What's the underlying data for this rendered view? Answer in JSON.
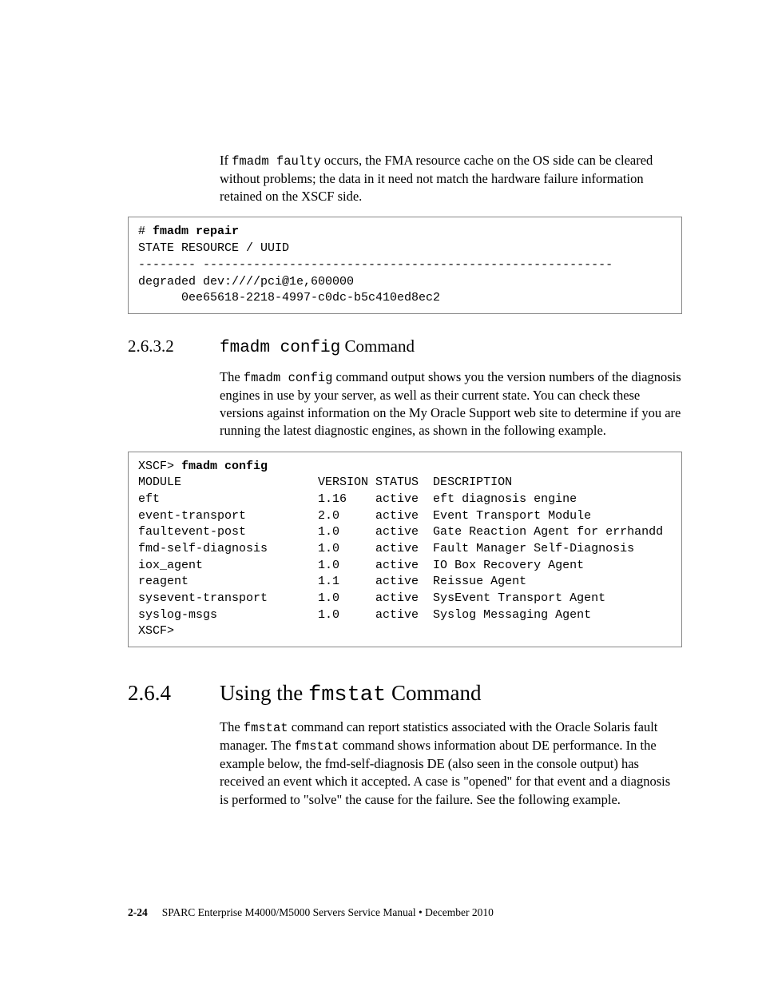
{
  "para1": {
    "pre": "If ",
    "code": "fmadm faulty",
    "post": " occurs, the FMA resource cache on the OS side can be cleared without problems; the data in it need not match the hardware failure information retained on the XSCF side."
  },
  "codebox1": {
    "prompt": "# ",
    "cmd": "fmadm repair",
    "line1": "STATE RESOURCE / UUID",
    "line2": "-------- ---------------------------------------------------------",
    "line3": "degraded dev:////pci@1e,600000",
    "line4": "      0ee65618-2218-4997-c0dc-b5c410ed8ec2"
  },
  "sec2632": {
    "num": "2.6.3.2",
    "title_pre": "",
    "title_code": "fmadm config",
    "title_post": " Command"
  },
  "para2": {
    "pre": "The ",
    "code": "fmadm config",
    "post": " command output shows you the version numbers of the diagnosis engines in use by your server, as well as their current state. You can check these versions against information on the My Oracle Support web site to determine if you are running the latest diagnostic engines, as shown in the following example."
  },
  "codebox2": {
    "prompt": "XSCF> ",
    "cmd": "fmadm config",
    "header": "MODULE                   VERSION STATUS  DESCRIPTION",
    "rows": [
      "eft                      1.16    active  eft diagnosis engine",
      "event-transport          2.0     active  Event Transport Module",
      "faultevent-post          1.0     active  Gate Reaction Agent for errhandd",
      "fmd-self-diagnosis       1.0     active  Fault Manager Self-Diagnosis",
      "iox_agent                1.0     active  IO Box Recovery Agent",
      "reagent                  1.1     active  Reissue Agent",
      "sysevent-transport       1.0     active  SysEvent Transport Agent",
      "syslog-msgs              1.0     active  Syslog Messaging Agent"
    ],
    "tail": "XSCF>"
  },
  "sec264": {
    "num": "2.6.4",
    "title_pre": "Using the ",
    "title_code": "fmstat",
    "title_post": " Command"
  },
  "para3": {
    "pre": "The ",
    "code1": " fmstat",
    "mid1": " command can report statistics associated with the Oracle Solaris fault manager. The ",
    "code2": "fmstat",
    "mid2": " command shows information about DE performance. In the example below, the fmd-self-diagnosis DE (also seen in the console output) has received an event which it accepted. A case is \"opened\" for that event and a diagnosis is performed to \"solve\" the cause for the failure. See the following example."
  },
  "footer": {
    "pgnum": "2-24",
    "text": "SPARC Enterprise M4000/M5000 Servers Service Manual • December 2010"
  },
  "chart_data": {
    "type": "table",
    "title": "fmadm config output",
    "columns": [
      "MODULE",
      "VERSION",
      "STATUS",
      "DESCRIPTION"
    ],
    "rows": [
      [
        "eft",
        "1.16",
        "active",
        "eft diagnosis engine"
      ],
      [
        "event-transport",
        "2.0",
        "active",
        "Event Transport Module"
      ],
      [
        "faultevent-post",
        "1.0",
        "active",
        "Gate Reaction Agent for errhandd"
      ],
      [
        "fmd-self-diagnosis",
        "1.0",
        "active",
        "Fault Manager Self-Diagnosis"
      ],
      [
        "iox_agent",
        "1.0",
        "active",
        "IO Box Recovery Agent"
      ],
      [
        "reagent",
        "1.1",
        "active",
        "Reissue Agent"
      ],
      [
        "sysevent-transport",
        "1.0",
        "active",
        "SysEvent Transport Agent"
      ],
      [
        "syslog-msgs",
        "1.0",
        "active",
        "Syslog Messaging Agent"
      ]
    ]
  }
}
